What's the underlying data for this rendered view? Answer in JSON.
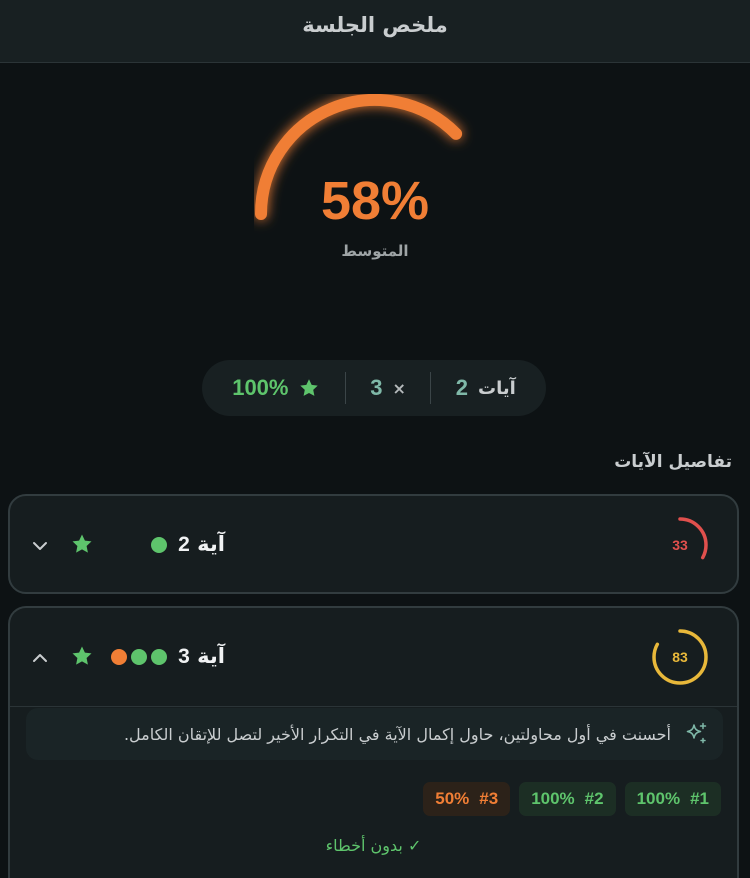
{
  "header": {
    "title": "ملخص الجلسة"
  },
  "summary": {
    "average_value": "58%",
    "average_fraction": 0.58,
    "average_label": "المتوسط",
    "accent_color": "#f07e35"
  },
  "stats": {
    "ayat_label": "آيات",
    "ayat_value": "2",
    "multiplier_symbol": "×",
    "multiplier_value": "3",
    "mastery_value": "100%",
    "mastery_icon": "star-icon"
  },
  "details": {
    "title": "تفاصيل الآيات",
    "items": [
      {
        "aya_label": "آية",
        "aya_number": "2",
        "score": "33",
        "score_fraction": 0.33,
        "score_color": "#e0504d",
        "dots": [
          "#5ec46c"
        ],
        "expanded": false
      },
      {
        "aya_label": "آية",
        "aya_number": "3",
        "score": "83",
        "score_fraction": 0.83,
        "score_color": "#e8b83a",
        "dots": [
          "#f07e35",
          "#5ec46c",
          "#5ec46c"
        ],
        "expanded": true,
        "tip": "أحسنت في أول محاولتين، حاول إكمال الآية في التكرار الأخير لتصل للإتقان الكامل.",
        "attempts": [
          {
            "label": "#1",
            "value": "100%",
            "color": "green"
          },
          {
            "label": "#2",
            "value": "100%",
            "color": "green"
          },
          {
            "label": "#3",
            "value": "50%",
            "color": "orange"
          }
        ],
        "status": "✓ بدون أخطاء"
      }
    ]
  }
}
